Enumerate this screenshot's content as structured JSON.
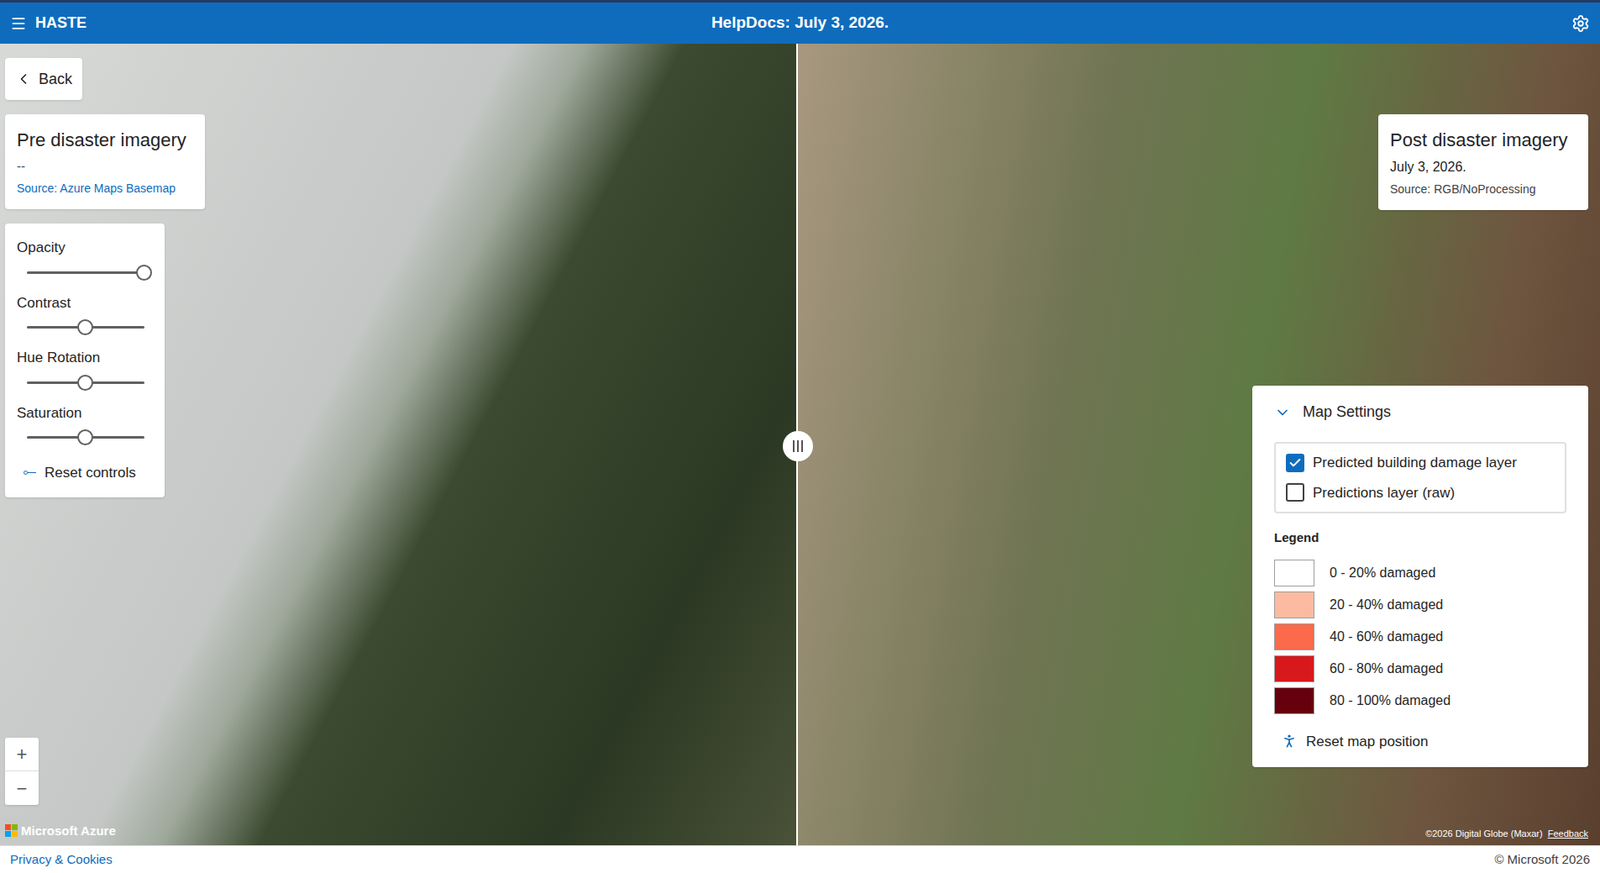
{
  "header": {
    "app_name": "HASTE",
    "title": "HelpDocs: July 3, 2026."
  },
  "back_button": {
    "label": "Back"
  },
  "pre_card": {
    "title": "Pre disaster imagery",
    "date": "--",
    "source": "Source: Azure Maps Basemap"
  },
  "post_card": {
    "title": "Post disaster imagery",
    "date": "July 3, 2026.",
    "source": "Source: RGB/NoProcessing"
  },
  "image_controls": {
    "sliders": [
      {
        "label": "Opacity",
        "level": 1
      },
      {
        "label": "Contrast",
        "level": 0.5
      },
      {
        "label": "Hue Rotation",
        "level": 0.5
      },
      {
        "label": "Saturation",
        "level": 0.5
      }
    ],
    "reset": "Reset controls"
  },
  "map_settings": {
    "title": "Map Settings",
    "expanded": true,
    "layers": [
      {
        "label": "Predicted building damage layer",
        "checked": true
      },
      {
        "label": "Predictions layer (raw)",
        "checked": false
      }
    ],
    "legend_title": "Legend",
    "legend": [
      {
        "label": "0 - 20% damaged",
        "color": "#ffffff"
      },
      {
        "label": "20 - 40% damaged",
        "color": "#fcbba1"
      },
      {
        "label": "40 - 60% damaged",
        "color": "#fb6a4a"
      },
      {
        "label": "60 - 80% damaged",
        "color": "#d7191c"
      },
      {
        "label": "80 - 100% damaged",
        "color": "#67000d"
      }
    ],
    "reset": "Reset map position"
  },
  "zoom": {
    "in": "+",
    "out": "−"
  },
  "attribution": {
    "brand": "Microsoft Azure",
    "credit": "©2026 Digital Globe (Maxar)",
    "feedback": "Feedback"
  },
  "footer": {
    "privacy": "Privacy & Cookies",
    "copyright": "© Microsoft 2026"
  }
}
